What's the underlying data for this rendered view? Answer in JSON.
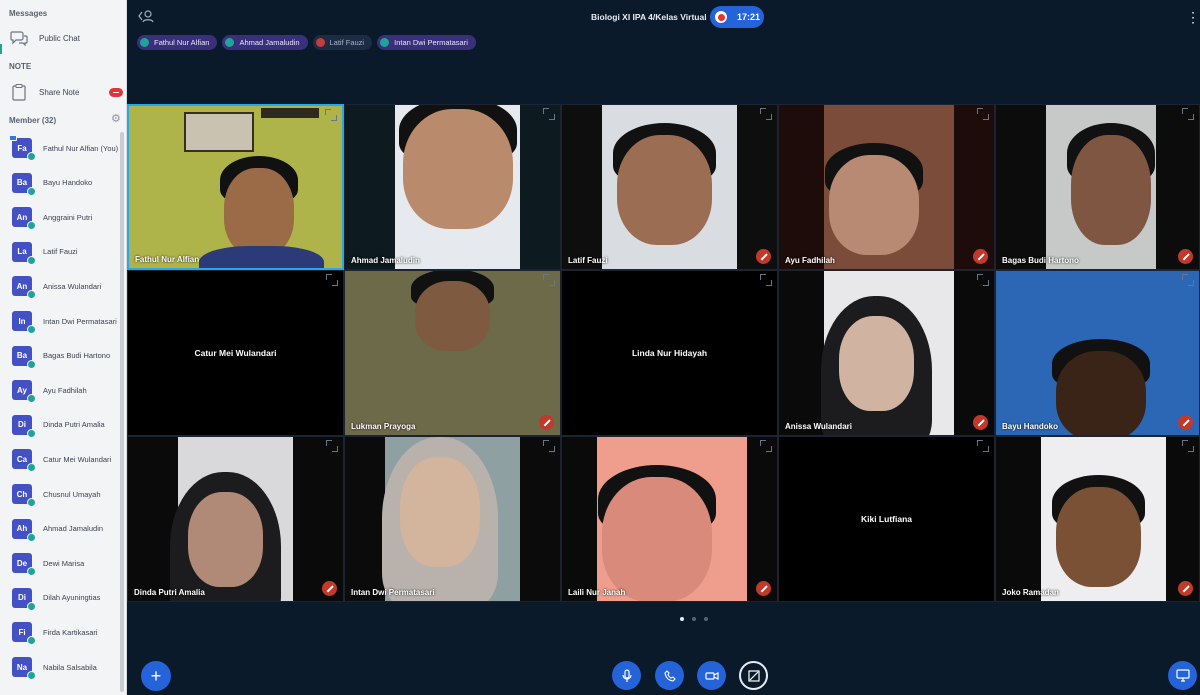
{
  "sidebar": {
    "messages_title": "Messages",
    "public_chat": "Public Chat",
    "note_title": "NOTE",
    "share_note": "Share Note",
    "members_title": "Member (32)",
    "members": [
      {
        "initials": "Fa",
        "name": "Fathul Nur Alfian (You)"
      },
      {
        "initials": "Ba",
        "name": "Bayu Handoko"
      },
      {
        "initials": "An",
        "name": "Anggraini Putri"
      },
      {
        "initials": "La",
        "name": "Latif Fauzi"
      },
      {
        "initials": "An",
        "name": "Anissa Wulandari"
      },
      {
        "initials": "In",
        "name": "Intan Dwi Permatasari"
      },
      {
        "initials": "Ba",
        "name": "Bagas Budi Hartono"
      },
      {
        "initials": "Ay",
        "name": "Ayu Fadhilah"
      },
      {
        "initials": "Di",
        "name": "Dinda Putri Amalia"
      },
      {
        "initials": "Ca",
        "name": "Catur Mei Wulandari"
      },
      {
        "initials": "Ch",
        "name": "Chusnul Umayah"
      },
      {
        "initials": "Ah",
        "name": "Ahmad Jamaludin"
      },
      {
        "initials": "De",
        "name": "Dewi Marisa"
      },
      {
        "initials": "Di",
        "name": "Dilah Ayuningtias"
      },
      {
        "initials": "Fi",
        "name": "Firda Kartikasari"
      },
      {
        "initials": "Na",
        "name": "Nabila Salsabila"
      }
    ]
  },
  "header": {
    "title": "Biologi XI IPA 4/Kelas Virtual",
    "timer": "17:21",
    "speakers": [
      {
        "name": "Fathul Nur Alfian",
        "muted": false
      },
      {
        "name": "Ahmad Jamaludin",
        "muted": false
      },
      {
        "name": "Latif Fauzi",
        "muted": true
      },
      {
        "name": "Intan Dwi Permatasari",
        "muted": false
      }
    ]
  },
  "tiles": [
    {
      "name": "Fathul Nur Alfian",
      "video": true,
      "muted": false,
      "active": true
    },
    {
      "name": "Ahmad Jamaludin",
      "video": true,
      "muted": false
    },
    {
      "name": "Latif Fauzi",
      "video": true,
      "muted": true
    },
    {
      "name": "Ayu Fadhilah",
      "video": true,
      "muted": true
    },
    {
      "name": "Bagas Budi Hartono",
      "video": true,
      "muted": true
    },
    {
      "name": "Catur Mei Wulandari",
      "video": false,
      "muted": false
    },
    {
      "name": "Lukman Prayoga",
      "video": true,
      "muted": true
    },
    {
      "name": "Linda Nur Hidayah",
      "video": false,
      "muted": false
    },
    {
      "name": "Anissa Wulandari",
      "video": true,
      "muted": true
    },
    {
      "name": "Bayu Handoko",
      "video": true,
      "muted": true
    },
    {
      "name": "Dinda Putri Amalia",
      "video": true,
      "muted": true
    },
    {
      "name": "Intan Dwi Permatasari",
      "video": true,
      "muted": false
    },
    {
      "name": "Laili Nur Janah",
      "video": true,
      "muted": true
    },
    {
      "name": "Kiki Lutfiana",
      "video": false,
      "muted": false
    },
    {
      "name": "Joko Ramadan",
      "video": true,
      "muted": true
    }
  ],
  "pager": {
    "pages": 3,
    "current": 1
  },
  "colors": {
    "accent": "#2563d9",
    "active_border": "#2aa7e8",
    "mute": "#c0392b"
  }
}
